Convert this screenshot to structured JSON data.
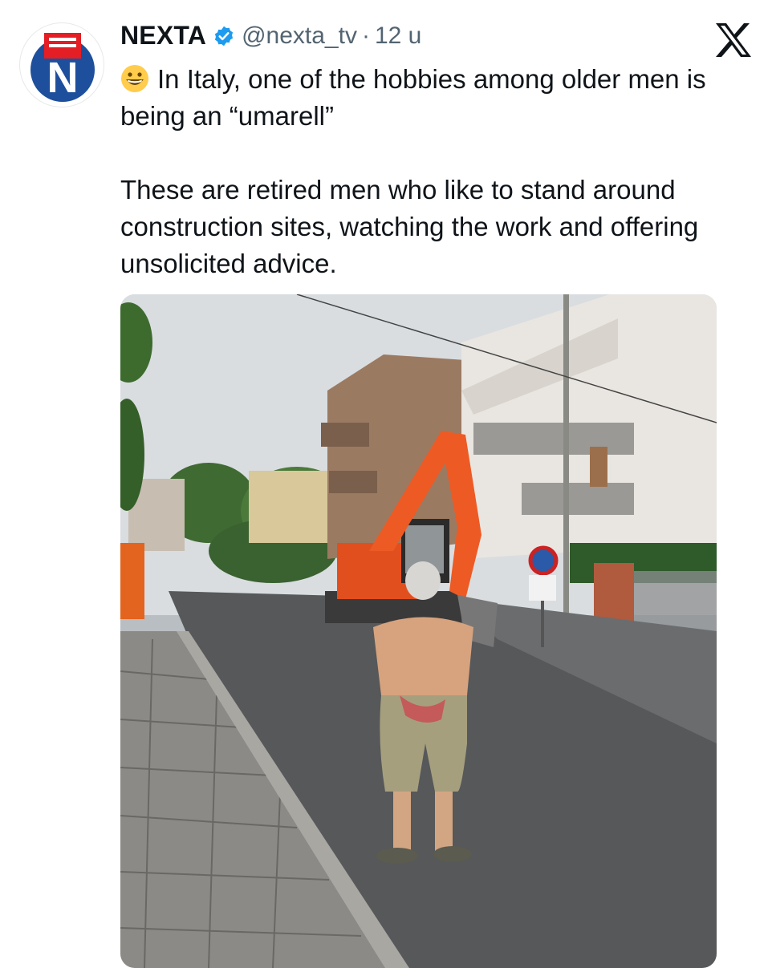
{
  "tweet": {
    "author_name": "NEXTA",
    "author_handle": "@nexta_tv",
    "separator": "·",
    "timestamp": "12 u",
    "line1": "In Italy, one of the hobbies among older men is being an “umarell”",
    "line2": "These are retired men who like to stand around construction sites, watching the work and offering unsolicited advice."
  },
  "icons": {
    "avatar": "nexta-logo-icon",
    "verified": "verified-badge-icon",
    "platform": "x-logo-icon",
    "emoji": "grinning-face-emoji-icon"
  },
  "colors": {
    "verified": "#1d9bf0",
    "handle": "#536471",
    "nexta_red": "#e31e24",
    "nexta_blue": "#1d4f9c",
    "excavator": "#ee5a24"
  },
  "media": {
    "type": "photo"
  }
}
